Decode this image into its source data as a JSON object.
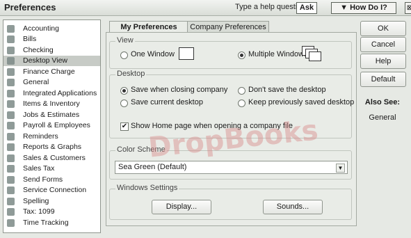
{
  "titlebar": {
    "title": "Preferences",
    "help_prompt": "Type a help question",
    "ask_label": "Ask",
    "howdo_label": "▼ How Do I?",
    "close_label": "⊠"
  },
  "sidebar": {
    "items": [
      {
        "label": "Accounting",
        "icon": "accounting-icon"
      },
      {
        "label": "Bills",
        "icon": "bills-icon"
      },
      {
        "label": "Checking",
        "icon": "checking-icon"
      },
      {
        "label": "Desktop View",
        "icon": "desktop-view-icon",
        "selected": true
      },
      {
        "label": "Finance Charge",
        "icon": "finance-charge-icon"
      },
      {
        "label": "General",
        "icon": "general-icon"
      },
      {
        "label": "Integrated Applications",
        "icon": "integrated-apps-icon"
      },
      {
        "label": "Items & Inventory",
        "icon": "items-inventory-icon"
      },
      {
        "label": "Jobs & Estimates",
        "icon": "jobs-estimates-icon"
      },
      {
        "label": "Payroll & Employees",
        "icon": "payroll-icon"
      },
      {
        "label": "Reminders",
        "icon": "reminders-icon"
      },
      {
        "label": "Reports & Graphs",
        "icon": "reports-graphs-icon"
      },
      {
        "label": "Sales & Customers",
        "icon": "sales-customers-icon"
      },
      {
        "label": "Sales Tax",
        "icon": "sales-tax-icon"
      },
      {
        "label": "Send Forms",
        "icon": "send-forms-icon"
      },
      {
        "label": "Service Connection",
        "icon": "service-connection-icon"
      },
      {
        "label": "Spelling",
        "icon": "spelling-icon"
      },
      {
        "label": "Tax: 1099",
        "icon": "tax-1099-icon"
      },
      {
        "label": "Time Tracking",
        "icon": "time-tracking-icon"
      }
    ]
  },
  "tabs": {
    "my_prefs": "My Preferences",
    "company_prefs": "Company Preferences"
  },
  "view": {
    "label": "View",
    "one_window": "One Window",
    "multiple_windows": "Multiple Windows"
  },
  "desktop": {
    "label": "Desktop",
    "save_when_closing": "Save when closing company",
    "dont_save": "Don't save the desktop",
    "save_current": "Save current desktop",
    "keep_previous": "Keep previously saved desktop",
    "show_home": "Show Home page when opening a company file"
  },
  "color_scheme": {
    "label": "Color Scheme",
    "selected": "Sea Green (Default)"
  },
  "windows_settings": {
    "label": "Windows Settings",
    "display_button": "Display...",
    "sounds_button": "Sounds..."
  },
  "right_buttons": {
    "ok": "OK",
    "cancel": "Cancel",
    "help": "Help",
    "default": "Default"
  },
  "also_see": {
    "title": "Also See:",
    "general": "General"
  },
  "watermark": "DropBooks"
}
